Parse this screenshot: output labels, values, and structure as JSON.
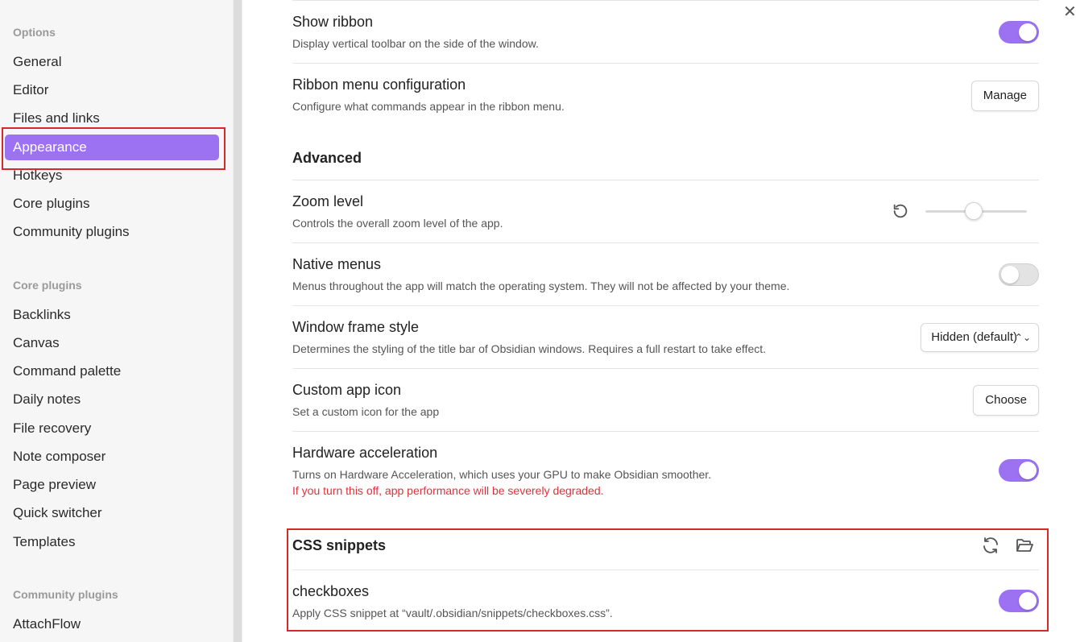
{
  "sidebar": {
    "options_heading": "Options",
    "options": [
      "General",
      "Editor",
      "Files and links",
      "Appearance",
      "Hotkeys",
      "Core plugins",
      "Community plugins"
    ],
    "active": "Appearance",
    "core_heading": "Core plugins",
    "core": [
      "Backlinks",
      "Canvas",
      "Command palette",
      "Daily notes",
      "File recovery",
      "Note composer",
      "Page preview",
      "Quick switcher",
      "Templates"
    ],
    "community_heading": "Community plugins",
    "community": [
      "AttachFlow"
    ]
  },
  "window": {
    "close_icon": "close-icon"
  },
  "settings": {
    "show_ribbon": {
      "name": "Show ribbon",
      "desc": "Display vertical toolbar on the side of the window.",
      "enabled": true
    },
    "ribbon_menu": {
      "name": "Ribbon menu configuration",
      "desc": "Configure what commands appear in the ribbon menu.",
      "button": "Manage"
    },
    "advanced_title": "Advanced",
    "zoom": {
      "name": "Zoom level",
      "desc": "Controls the overall zoom level of the app.",
      "reset_icon": "reset-icon"
    },
    "native_menus": {
      "name": "Native menus",
      "desc": "Menus throughout the app will match the operating system. They will not be affected by your theme.",
      "enabled": false
    },
    "frame_style": {
      "name": "Window frame style",
      "desc": "Determines the styling of the title bar of Obsidian windows. Requires a full restart to take effect.",
      "value": "Hidden (default)"
    },
    "app_icon": {
      "name": "Custom app icon",
      "desc": "Set a custom icon for the app",
      "button": "Choose"
    },
    "hw_accel": {
      "name": "Hardware acceleration",
      "desc": "Turns on Hardware Acceleration, which uses your GPU to make Obsidian smoother.",
      "warning": "If you turn this off, app performance will be severely degraded.",
      "enabled": true
    },
    "css_snippets_title": "CSS snippets",
    "snippets": [
      {
        "name": "checkboxes",
        "desc": "Apply CSS snippet at “vault/.obsidian/snippets/checkboxes.css”.",
        "enabled": true
      }
    ]
  },
  "colors": {
    "accent": "#9c72f3",
    "warning": "#e0313b",
    "highlight": "#d42a2a"
  }
}
